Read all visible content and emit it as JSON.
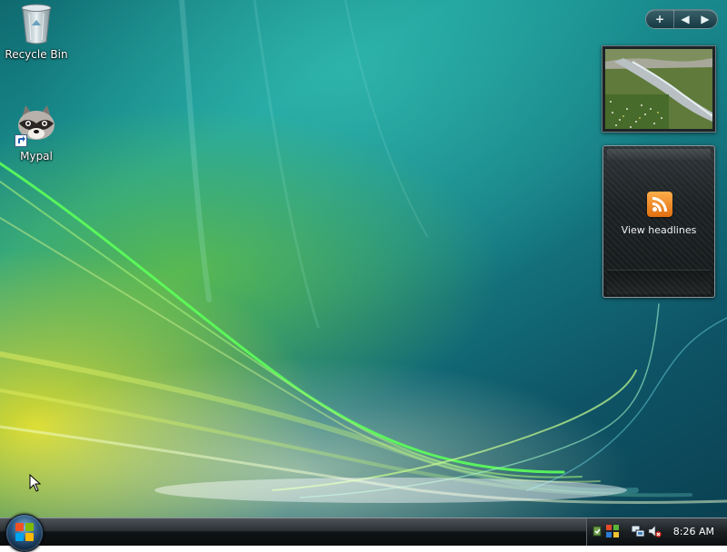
{
  "desktop": {
    "icons": [
      {
        "label": "Recycle Bin",
        "icon": "recycle-bin-icon"
      },
      {
        "label": "Mypal",
        "icon": "raccoon-browser-icon",
        "shortcut": true
      }
    ]
  },
  "sidebar": {
    "controls": {
      "add": "+",
      "prev": "◀",
      "next": "▶"
    },
    "feed_gadget": {
      "text": "View headlines",
      "icon": "rss-feed-icon"
    }
  },
  "taskbar": {
    "clock": "8:26 AM",
    "tray_icons": [
      "windows-defender-icon",
      "network-icon",
      "volume-muted-icon"
    ],
    "start_icon": "windows-logo-icon"
  }
}
